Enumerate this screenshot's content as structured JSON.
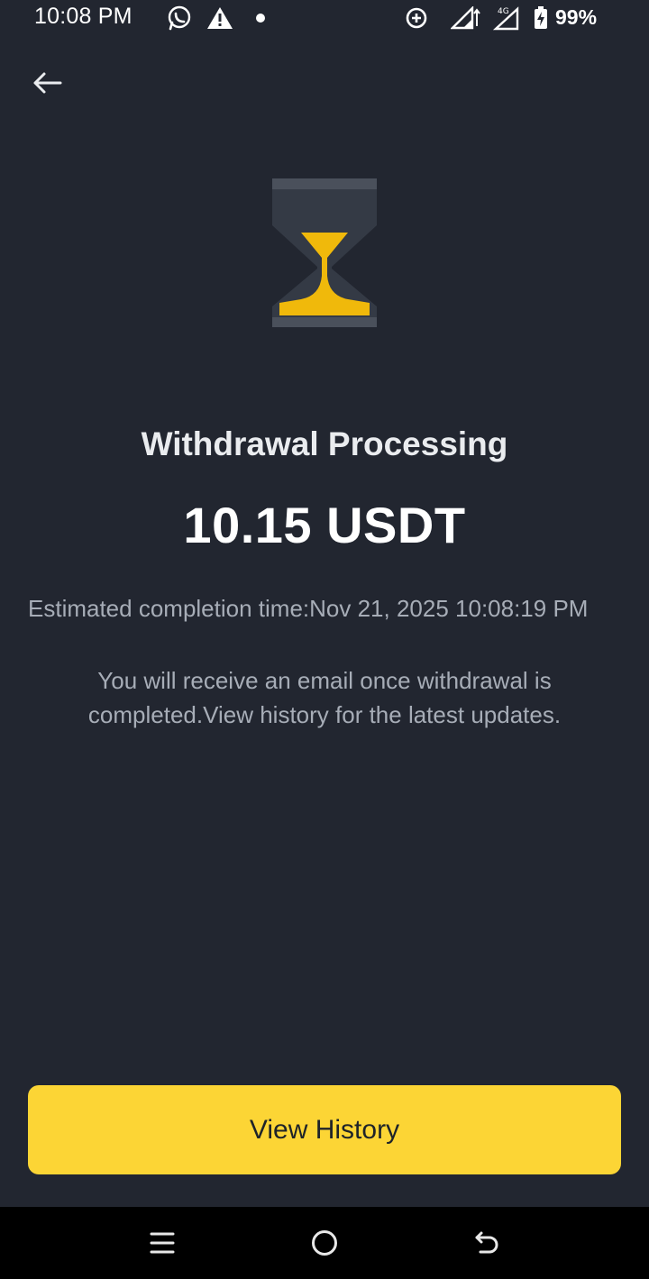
{
  "status_bar": {
    "time": "10:08 PM",
    "battery": "99%",
    "icons": [
      "whatsapp-icon",
      "warning-icon",
      "notification-dot-icon",
      "data-saver-icon",
      "signal-icon",
      "4g-signal-icon",
      "battery-charging-icon"
    ]
  },
  "header": {
    "back_icon": "arrow-left-icon"
  },
  "status": {
    "icon": "hourglass-icon",
    "title": "Withdrawal Processing",
    "amount": "10.15 USDT",
    "estimated_completion": "Estimated completion time:Nov 21, 2025 10:08:19 PM",
    "note": "You will receive an email once withdrawal is completed.View history for the latest updates."
  },
  "actions": {
    "view_history_label": "View History"
  },
  "nav_bar": {
    "icons": [
      "menu-icon",
      "home-icon",
      "back-icon"
    ]
  },
  "colors": {
    "background": "#222630",
    "accent": "#fcd535",
    "hourglass_body": "#343a45",
    "secondary_text": "#a7adb7"
  }
}
